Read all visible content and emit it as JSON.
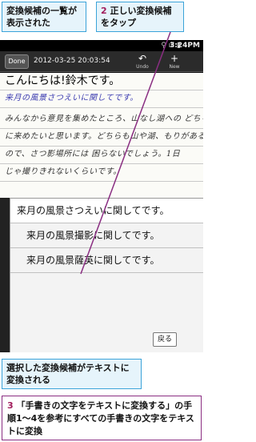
{
  "callouts": {
    "top_left": "変換候補の一覧が表示された",
    "top_right_num": "2",
    "top_right_text": "正しい変換候補をタップ",
    "mid_left": "選択した変換候補がテキストに変換される",
    "bottom_num": "3",
    "bottom_text": "「手書きの文字をテキストに変換する」の手順1〜4を参考にすべての手書きの文字をテキストに変換"
  },
  "status_bar": {
    "icons": "⚲ ıll ▮",
    "time": "3:24PM"
  },
  "toolbar": {
    "done_label": "Done",
    "datetime": "2012-03-25 20:03:54",
    "undo_icon": "undo-icon",
    "undo_label": "Undo",
    "new_icon": "plus-icon",
    "new_label": "New"
  },
  "note": {
    "line_0": "こんにちは!鈴木です。",
    "line_1": "来月の風景さつえいに関してです。",
    "line_2": "みんなから意見を集めたところ、山なし湖への どちらか",
    "line_3": "に来めたいと思います。どちらも山や湖、もりがある",
    "line_4": "ので、さつ影場所には 困らないでしょう。1日",
    "line_5": "じゃ撮りきれないくらいです。"
  },
  "candidates": {
    "items": [
      "来月の風景さつえいに関してです。",
      "来月の風景撮影に関してです。",
      "来月の風景薩英に関してです。"
    ],
    "back_label": "戻る"
  }
}
